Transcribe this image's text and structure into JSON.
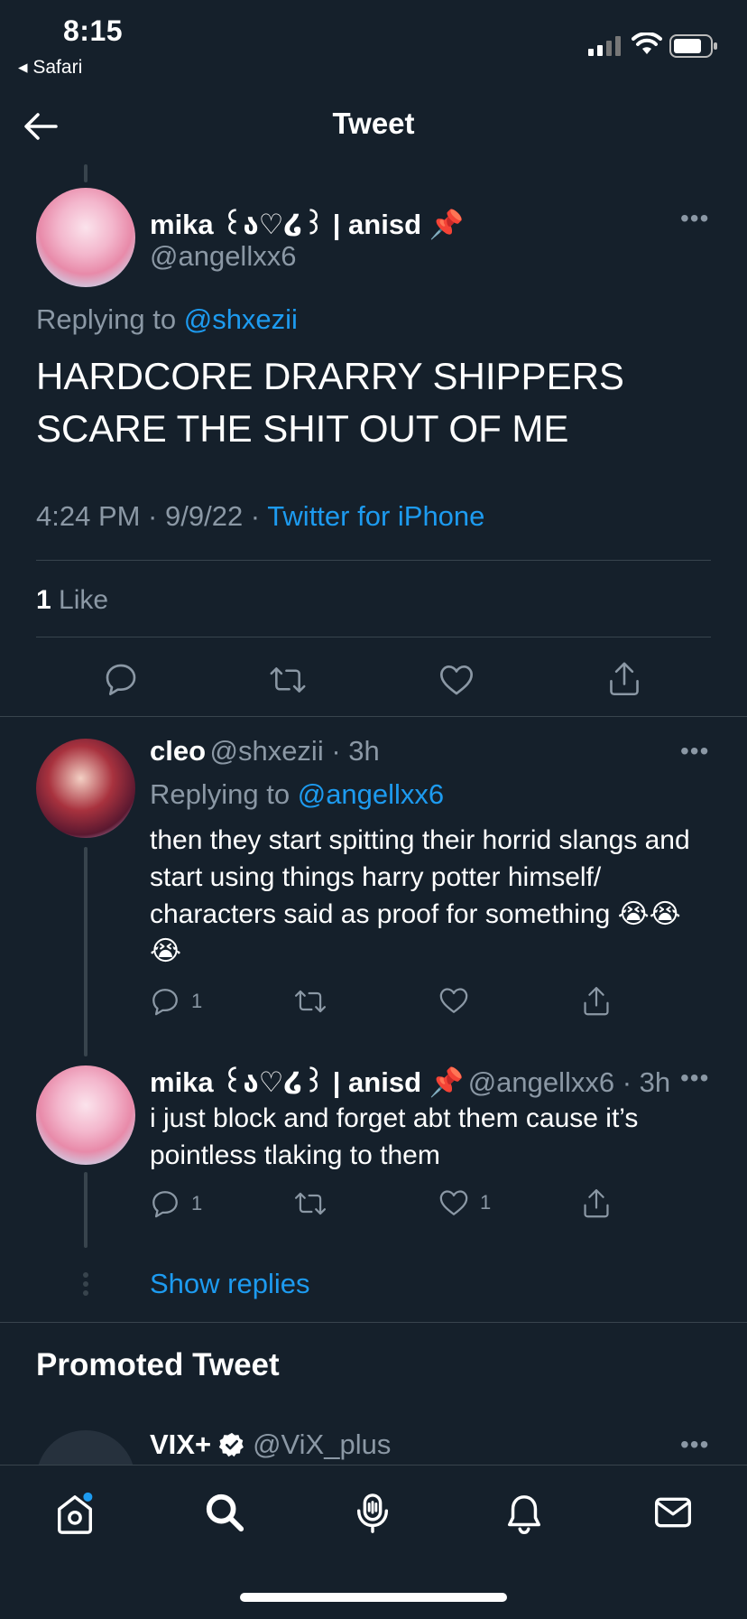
{
  "status_bar": {
    "time": "8:15",
    "back_app": "◂ Safari"
  },
  "header": {
    "title": "Tweet"
  },
  "main_tweet": {
    "name": "mika ꒰ა♡໒꒱ | anisd 📌",
    "handle": "@angellxx6",
    "replying_prefix": "Replying to ",
    "replying_to": "@shxezii",
    "text": "HARDCORE DRARRY SHIPPERS SCARE THE SHIT OUT OF ME",
    "timestamp": "4:24 PM · 9/9/22 · ",
    "source": "Twitter for iPhone",
    "likes_count": "1",
    "likes_label": " Like"
  },
  "replies": [
    {
      "name": "cleo",
      "handle": "@shxezii · 3h",
      "replying_prefix": "Replying to ",
      "replying_to": "@angellxx6",
      "text": "then they start spitting their horrid slangs and start using things harry potter himself/ characters said as proof for something 😭😭😭",
      "reply_count": "1",
      "retweet_count": "",
      "like_count": ""
    },
    {
      "name": "mika ꒰ა♡໒꒱ | anisd 📌",
      "handle": "@angellxx6 · 3h",
      "text": "i just block and forget abt them cause it’s pointless tlaking to them",
      "reply_count": "1",
      "retweet_count": "",
      "like_count": "1"
    }
  ],
  "show_replies": "Show replies",
  "promoted": {
    "heading": "Promoted Tweet",
    "name": "VIX+",
    "handle": "@ViX_plus"
  },
  "icons": {
    "back": "arrow-left-icon",
    "more": "more-icon",
    "reply": "reply-icon",
    "retweet": "retweet-icon",
    "like": "heart-icon",
    "share": "share-icon"
  },
  "colors": {
    "background": "#15202b",
    "accent": "#1d9bf0",
    "muted": "#8b98a5",
    "divider": "#38444d"
  }
}
